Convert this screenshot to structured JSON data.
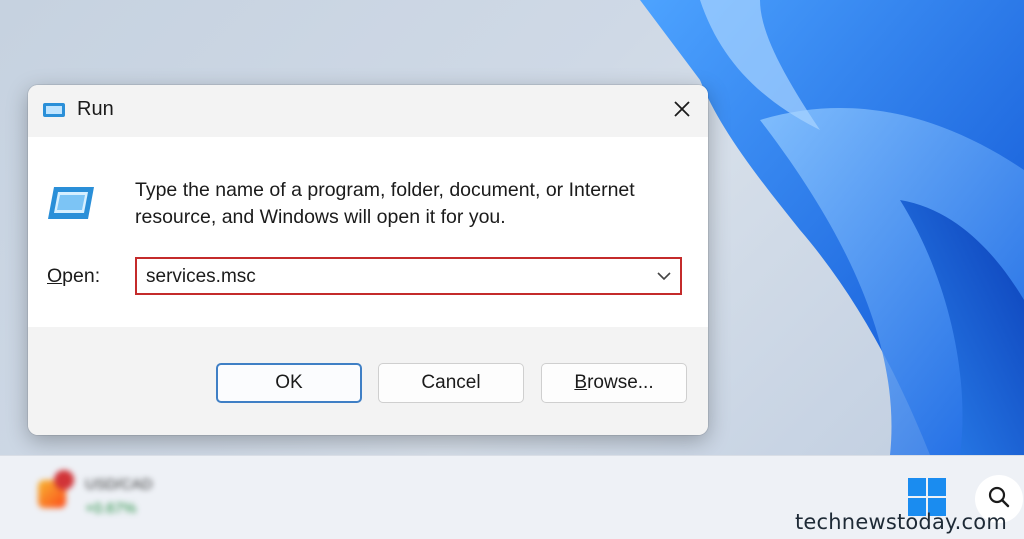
{
  "dialog": {
    "title": "Run",
    "description": "Type the name of a program, folder, document, or Internet resource, and Windows will open it for you.",
    "open_label_accel": "O",
    "open_label_rest": "pen:",
    "input_value": "services.msc",
    "ok_label": "OK",
    "cancel_label": "Cancel",
    "browse_label_accel": "B",
    "browse_label_rest": "rowse..."
  },
  "taskbar": {
    "widget_label": "USD/CAD",
    "widget_change": "+0.67%"
  },
  "watermark": "technewstoday.com",
  "colors": {
    "input_highlight": "#c42b2b",
    "ok_border": "#3f7fc5",
    "wallpaper_blue": "#1f6fe0"
  },
  "icons": {
    "title": "run-icon",
    "close": "close-icon",
    "content": "run-icon",
    "dropdown": "chevron-down-icon",
    "start": "windows-start-icon",
    "search": "search-icon"
  }
}
